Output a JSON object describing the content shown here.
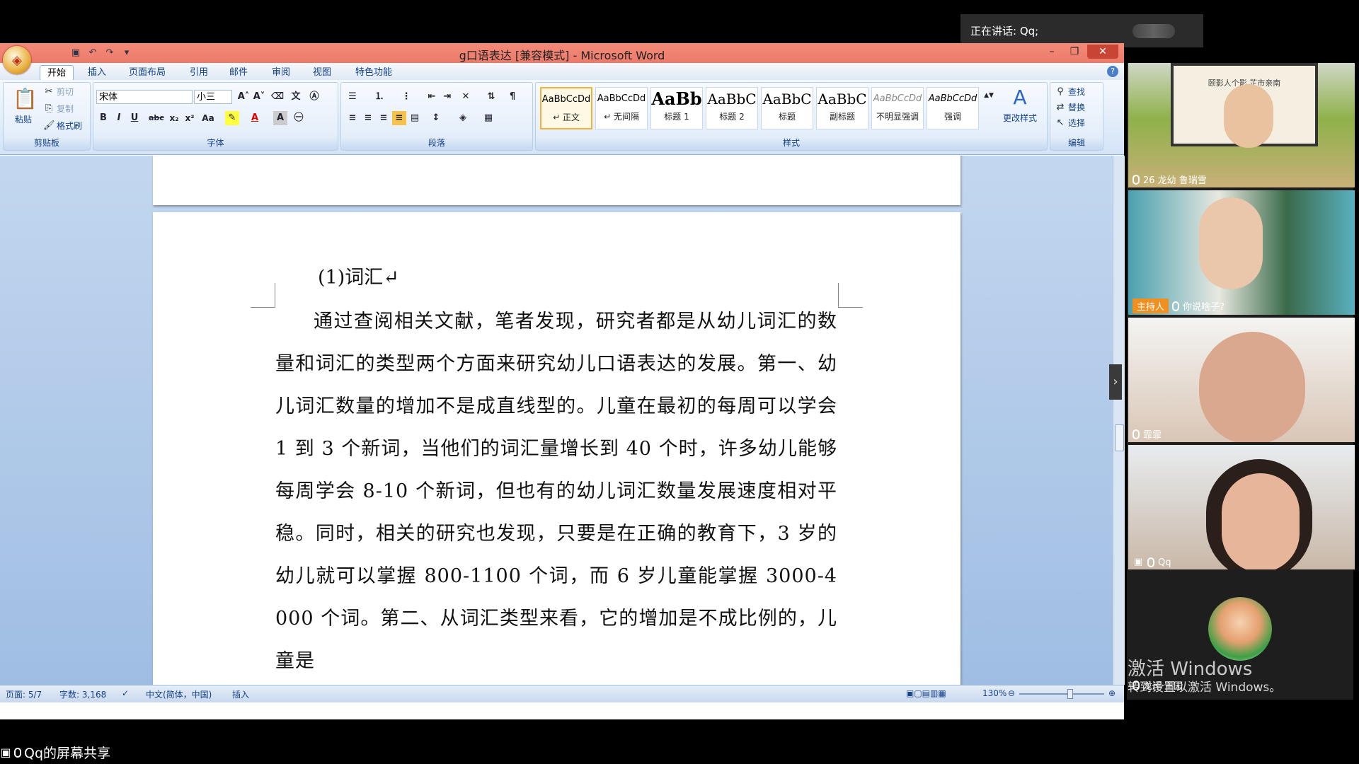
{
  "meeting": {
    "speaking": "正在讲话: Qq;",
    "share_label": "Qq的屏幕共享",
    "participants": [
      {
        "name": "26 龙幼 鲁瑞雪",
        "host": false
      },
      {
        "name": "你说啥子?",
        "host": true,
        "host_label": "主持人"
      },
      {
        "name": "霏霏",
        "host": false
      },
      {
        "name": "Qq",
        "host": false
      },
      {
        "name": "龙岸·王园",
        "host": false
      }
    ],
    "activate_line1": "激活 Windows",
    "activate_line2": "转到设置以激活 Windows。",
    "backdrop_text": "颐影人个影    芷市亲南"
  },
  "word": {
    "title": "g口语表达 [兼容模式] - Microsoft Word",
    "tabs": [
      "开始",
      "插入",
      "页面布局",
      "引用",
      "邮件",
      "审阅",
      "视图",
      "特色功能"
    ],
    "clipboard": {
      "paste": "粘贴",
      "cut": "剪切",
      "copy": "复制",
      "format_painter": "格式刷",
      "label": "剪贴板"
    },
    "font": {
      "name": "宋体",
      "size": "小三",
      "label": "字体"
    },
    "paragraph": {
      "label": "段落"
    },
    "styles": {
      "label": "样式",
      "items": [
        {
          "preview": "AaBbCcDd",
          "name": "↵ 正文"
        },
        {
          "preview": "AaBbCcDd",
          "name": "↵ 无间隔"
        },
        {
          "preview": "AaBb",
          "name": "标题 1"
        },
        {
          "preview": "AaBbC",
          "name": "标题 2"
        },
        {
          "preview": "AaBbC",
          "name": "标题"
        },
        {
          "preview": "AaBbC",
          "name": "副标题"
        },
        {
          "preview": "AaBbCcDd",
          "name": "不明显强调"
        },
        {
          "preview": "AaBbCcDd",
          "name": "强调"
        }
      ],
      "change": "更改样式"
    },
    "editing": {
      "find": "查找",
      "replace": "替换",
      "select": "选择",
      "label": "编辑"
    },
    "document": {
      "heading": "(1)词汇↵",
      "body": "通过查阅相关文献，笔者发现，研究者都是从幼儿词汇的数量和词汇的类型两个方面来研究幼儿口语表达的发展。第一、幼儿词汇数量的增加不是成直线型的。儿童在最初的每周可以学会 1 到 3 个新词，当他们的词汇量增长到 40 个时，许多幼儿能够每周学会 8-10 个新词，但也有的幼儿词汇数量发展速度相对平稳。同时，相关的研究也发现，只要是在正确的教育下，3 岁的幼儿就可以掌握 800-1100 个词，而 6 岁儿童能掌握 3000-4000 个词。第二、从词汇类型来看，它的增加是不成比例的，儿童是"
    },
    "status": {
      "page": "页面: 5/7",
      "words": "字数: 3,168",
      "language": "中文(简体，中国)",
      "mode": "插入",
      "zoom": "130%"
    }
  },
  "colors": {
    "titlebar": "#ec7a6a",
    "ribbon_text": "#15428b",
    "host_badge": "#f09020"
  }
}
